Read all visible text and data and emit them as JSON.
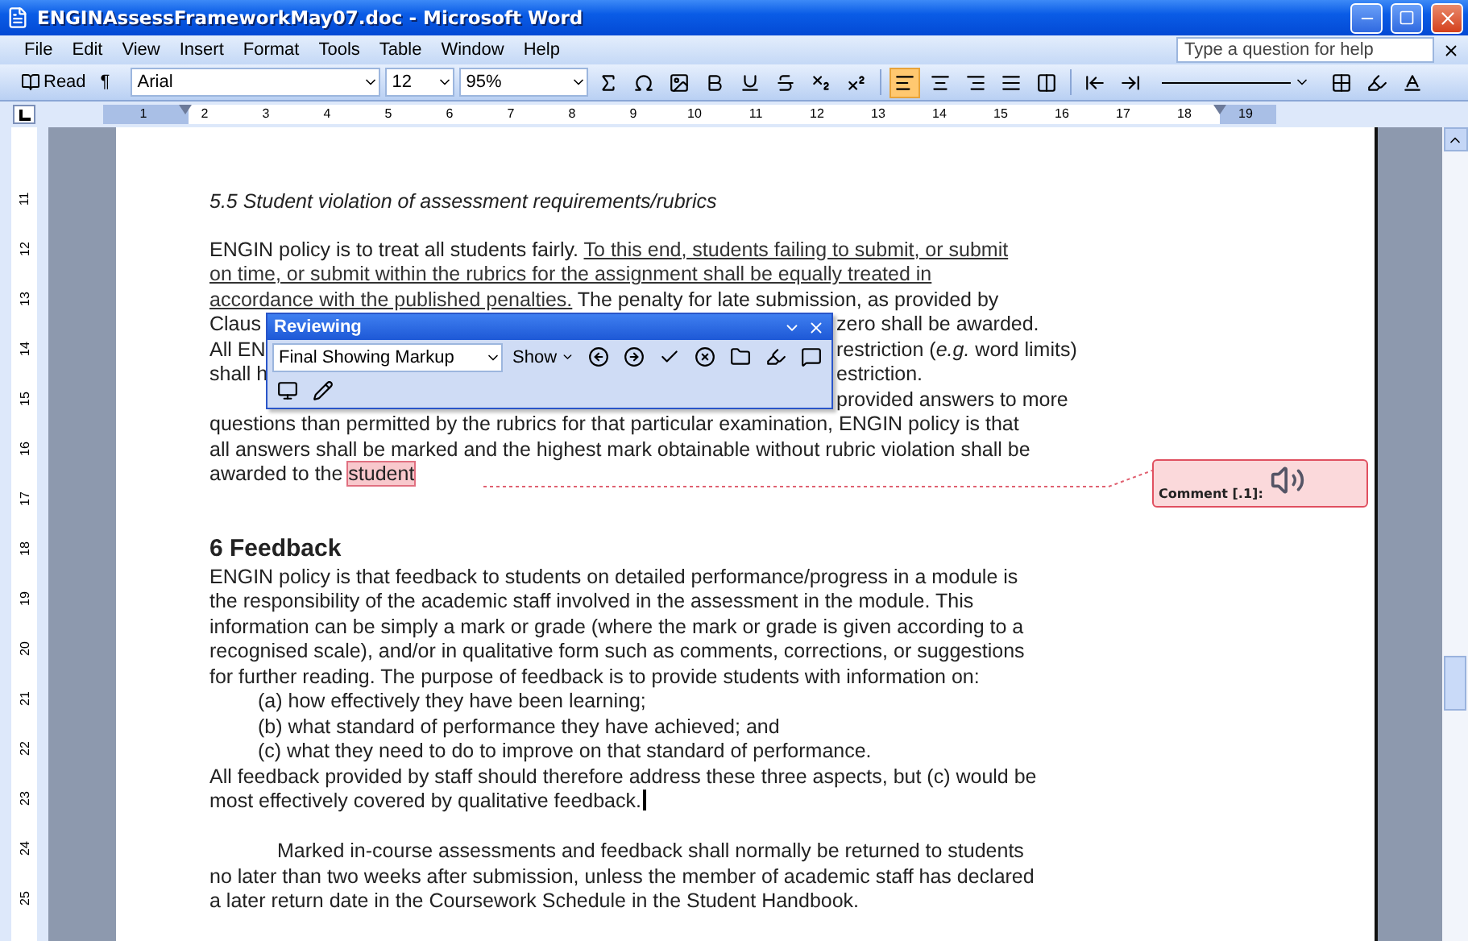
{
  "window": {
    "title": "ENGINAssessFrameworkMay07.doc - Microsoft Word"
  },
  "menu": [
    "File",
    "Edit",
    "View",
    "Insert",
    "Format",
    "Tools",
    "Table",
    "Window",
    "Help"
  ],
  "help_box": {
    "placeholder": "Type a question for help"
  },
  "toolbar": {
    "read": "Read",
    "pilcrow": "¶",
    "font": "Arial",
    "size": "12",
    "zoom": "95%",
    "alignment": [
      {
        "kind": "left",
        "selected": true
      },
      {
        "kind": "center",
        "selected": false
      },
      {
        "kind": "right",
        "selected": false
      },
      {
        "kind": "justify",
        "selected": false
      }
    ]
  },
  "ruler": {
    "horizontal": [
      "1",
      "2",
      "3",
      "4",
      "5",
      "6",
      "7",
      "8",
      "9",
      "10",
      "11",
      "12",
      "13",
      "14",
      "15",
      "16",
      "17",
      "18",
      "19"
    ],
    "vertical": [
      "11",
      "12",
      "13",
      "14",
      "15",
      "16",
      "17",
      "18",
      "19",
      "20",
      "21",
      "22",
      "23",
      "24",
      "25"
    ]
  },
  "section_5_5": {
    "heading": "5.5 Student violation of assessment requirements/rubrics",
    "lines": [
      {
        "kind": "full",
        "segments": [
          {
            "text": "ENGIN policy is to treat all students fairly.  ",
            "underlined": false,
            "commented": false
          },
          {
            "text": "To this end, students failing to submit, or submit",
            "underlined": true,
            "commented": false
          }
        ]
      },
      {
        "kind": "full",
        "segments": [
          {
            "text": "on time, or submit within the rubrics for the assignment shall be equally treated in",
            "underlined": true,
            "commented": false
          }
        ]
      },
      {
        "kind": "full",
        "segments": [
          {
            "text": "accordance with the published penalties.",
            "underlined": true,
            "commented": false
          },
          {
            "text": "  The penalty for late submission, as provided by",
            "underlined": false,
            "commented": false
          }
        ]
      },
      {
        "kind": "split",
        "left": "Claus",
        "right": "zero shall be awarded."
      },
      {
        "kind": "split",
        "left": "All EN",
        "right": "restriction (*e.g.* word limits)"
      },
      {
        "kind": "split",
        "left": "shall h",
        "right": "estriction."
      },
      {
        "kind": "split",
        "right": "provided answers to more"
      },
      {
        "kind": "full",
        "segments": [
          {
            "text": "questions than permitted by the rubrics for that particular examination, ENGIN policy is that",
            "underlined": false,
            "commented": false
          }
        ]
      },
      {
        "kind": "full",
        "segments": [
          {
            "text": "all answers shall be marked and the highest mark obtainable without rubric violation shall be",
            "underlined": false,
            "commented": false
          }
        ]
      },
      {
        "kind": "full",
        "segments": [
          {
            "text": "awarded to the ",
            "underlined": false,
            "commented": false
          },
          {
            "text": "student",
            "underlined": false,
            "commented": true
          }
        ]
      }
    ]
  },
  "section_6": {
    "heading": "6  Feedback",
    "intro": [
      "ENGIN policy is that feedback to students on detailed performance/progress in a module is",
      "the responsibility of the academic staff involved in the assessment in the module.  This",
      "information can be simply a mark or grade (where the mark or grade is given according to a",
      "recognised scale), and/or in qualitative form such as comments, corrections, or suggestions",
      "for further reading.  The purpose of feedback is to provide students with information on:"
    ],
    "items": [
      "(a) how effectively they have been learning;",
      "(b) what standard of performance they have achieved; and",
      "(c) what they need to do to improve on that standard of performance."
    ],
    "summary": [
      "All feedback provided by staff should therefore address these three aspects, but (c) would be",
      "most effectively covered by qualitative feedback."
    ],
    "return": [
      "Marked in-course assessments and feedback shall normally be returned to students",
      "no later than two weeks after submission, unless the member of academic staff has declared",
      "a later return date in the Coursework Schedule in the Student Handbook."
    ]
  },
  "reviewing_toolbar": {
    "title": "Reviewing",
    "display": "Final Showing Markup",
    "show": "Show"
  },
  "comment": {
    "label": "Comment [.1]:"
  }
}
